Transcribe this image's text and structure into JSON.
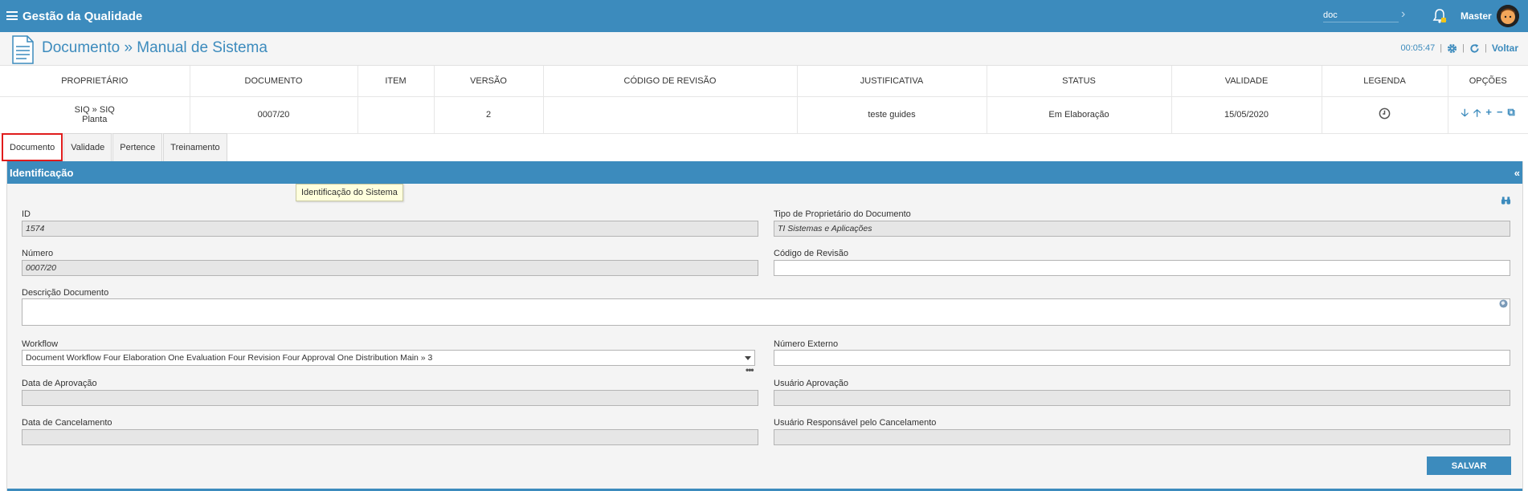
{
  "app": {
    "title": "Gestão da Qualidade"
  },
  "topbar": {
    "search_value": "doc",
    "user_name": "Master"
  },
  "header": {
    "title": "Documento » Manual de Sistema",
    "timer": "00:05:47",
    "back_label": "Voltar"
  },
  "summary": {
    "columns": [
      "PROPRIETÁRIO",
      "DOCUMENTO",
      "ITEM",
      "VERSÃO",
      "CÓDIGO DE REVISÃO",
      "JUSTIFICATIVA",
      "STATUS",
      "VALIDADE",
      "LEGENDA",
      "OPÇÕES"
    ],
    "row": {
      "owner_line1": "SIQ » SIQ",
      "owner_line2": "Planta",
      "document": "0007/20",
      "item": "",
      "version": "2",
      "revision_code": "",
      "justification": "teste guides",
      "status": "Em Elaboração",
      "validity": "15/05/2020"
    }
  },
  "tabs": [
    "Documento",
    "Validade",
    "Pertence",
    "Treinamento"
  ],
  "panel": {
    "title": "Identificação",
    "tooltip": "Identificação do Sistema"
  },
  "form": {
    "id_label": "ID",
    "id_value": "1574",
    "owner_type_label": "Tipo de Proprietário do Documento",
    "owner_type_value": "TI Sistemas e Aplicações",
    "number_label": "Número",
    "number_value": "0007/20",
    "revision_code_label": "Código de Revisão",
    "revision_code_value": "",
    "description_label": "Descrição Documento",
    "description_value": "",
    "workflow_label": "Workflow",
    "workflow_value": "Document Workflow Four Elaboration One Evaluation Four Revision Four Approval One Distribution Main » 3",
    "external_number_label": "Número Externo",
    "external_number_value": "",
    "approval_date_label": "Data de Aprovação",
    "approval_date_value": "",
    "approval_user_label": "Usuário Aprovação",
    "approval_user_value": "",
    "cancel_date_label": "Data de Cancelamento",
    "cancel_date_value": "",
    "cancel_user_label": "Usuário Responsável pelo Cancelamento",
    "cancel_user_value": ""
  },
  "actions": {
    "save_label": "SALVAR"
  },
  "colors": {
    "primary": "#3c8bbd",
    "active_tab_border": "#e01c1c",
    "tooltip_bg": "#ffffdd"
  }
}
